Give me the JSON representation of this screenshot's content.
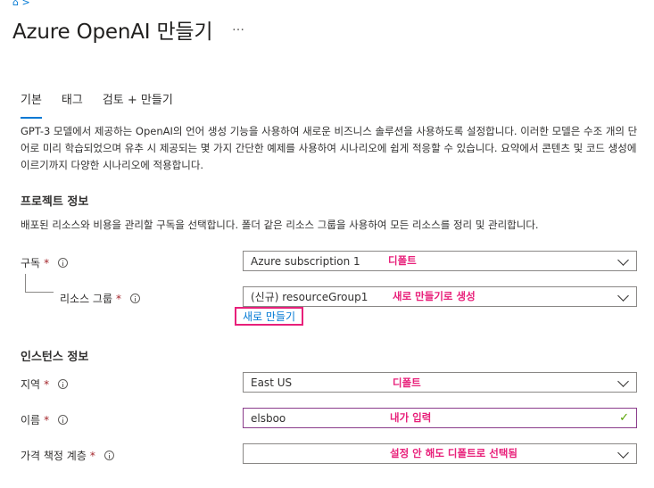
{
  "page": {
    "title": "Azure OpenAI 만들기",
    "more_icon": "…"
  },
  "tabs": [
    {
      "label": "기본"
    },
    {
      "label": "태그"
    },
    {
      "label": "검토 + 만들기"
    }
  ],
  "intro": {
    "text": "GPT-3 모델에서 제공하는 OpenAI의 언어 생성 기능을 사용하여 새로운 비즈니스 솔루션을 사용하도록 설정합니다. 이러한 모델은 수조 개의 단어로 미리 학습되었으며 유추 시 제공되는 몇 가지 간단한 예제를 사용하여 시나리오에 쉽게 적응할 수 있습니다. 요약에서 콘텐츠 및 코드 생성에 이르기까지 다양한 시나리오에 적용합니다."
  },
  "project_details": {
    "title": "프로젝트 정보",
    "description": "배포된 리소스와 비용을 관리할 구독을 선택합니다. 폴더 같은 리소스 그룹을 사용하여 모든 리소스를 정리 및 관리합니다.",
    "subscription": {
      "label": "구독",
      "value": "Azure subscription 1",
      "annotation": "디폴트"
    },
    "resource_group": {
      "label": "리소스 그룹",
      "value": "(신규) resourceGroup1",
      "annotation": "새로 만들기로 생성",
      "create_new_label": "새로 만들기"
    }
  },
  "instance_details": {
    "title": "인스턴스 정보",
    "region": {
      "label": "지역",
      "value": "East US",
      "annotation": "디폴트"
    },
    "name": {
      "label": "이름",
      "value": "elsboo",
      "annotation": "내가 입력"
    },
    "pricing_tier": {
      "label": "가격 책정 계층",
      "value": "",
      "annotation": "설정 안 해도 디폴트로 선택됨"
    }
  },
  "required_marker": "*",
  "colors": {
    "accent": "#0078d4",
    "annotation": "#e8207a",
    "valid": "#57a300",
    "required": "#a4262c"
  }
}
